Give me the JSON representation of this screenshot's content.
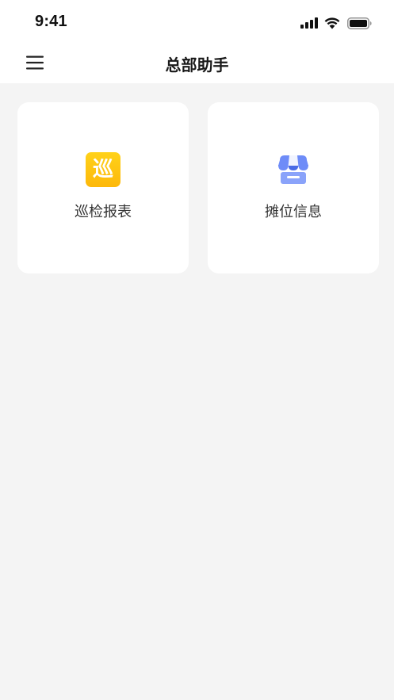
{
  "status_bar": {
    "time": "9:41",
    "icons": [
      "signal-icon",
      "wifi-icon",
      "battery-icon"
    ]
  },
  "nav": {
    "menu_icon": "menu-icon",
    "title": "总部助手"
  },
  "cards": [
    {
      "label": "巡检报表",
      "icon": "inspection-report-icon",
      "icon_text": "巡",
      "icon_color": "#FFC20E"
    },
    {
      "label": "摊位信息",
      "icon": "storefront-icon",
      "icon_color": "#6E8CF8"
    }
  ],
  "colors": {
    "background": "#F4F4F4",
    "surface": "#FFFFFF",
    "title_text": "#1A1A1A",
    "label_text": "#333333"
  }
}
